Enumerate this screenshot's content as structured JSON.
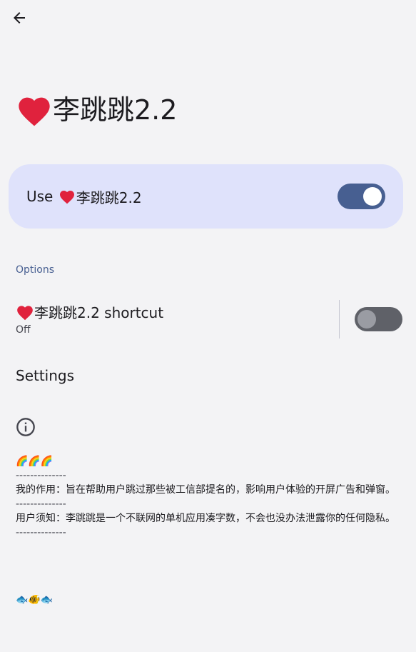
{
  "header": {
    "back_icon": "arrow-back-icon"
  },
  "page": {
    "title_heart": "❤️",
    "title_text": "李跳跳2.2"
  },
  "main_switch": {
    "label_prefix": "Use ",
    "label_heart": "❤️",
    "label_name": "李跳跳2.2",
    "state": "on",
    "accent_color": "#475f91",
    "card_color": "#dfe2fb"
  },
  "options": {
    "header": "Options",
    "shortcut": {
      "heart": "❤️",
      "title": "李跳跳2.2 shortcut",
      "summary": "Off",
      "state": "off"
    },
    "settings_label": "Settings"
  },
  "footer": {
    "info_icon": "info-circle-icon",
    "rainbows": "🌈🌈🌈",
    "separator1": "--------------",
    "purpose": "我的作用：旨在帮助用户跳过那些被工信部提名的，影响用户体验的开屏广告和弹窗。",
    "separator2": "--------------",
    "notice": "用户须知：李跳跳是一个不联网的单机应用凑字数，不会也没办法泄露你的任何隐私。",
    "separator3": "--------------",
    "fishes": "🐟🐠🐟"
  }
}
